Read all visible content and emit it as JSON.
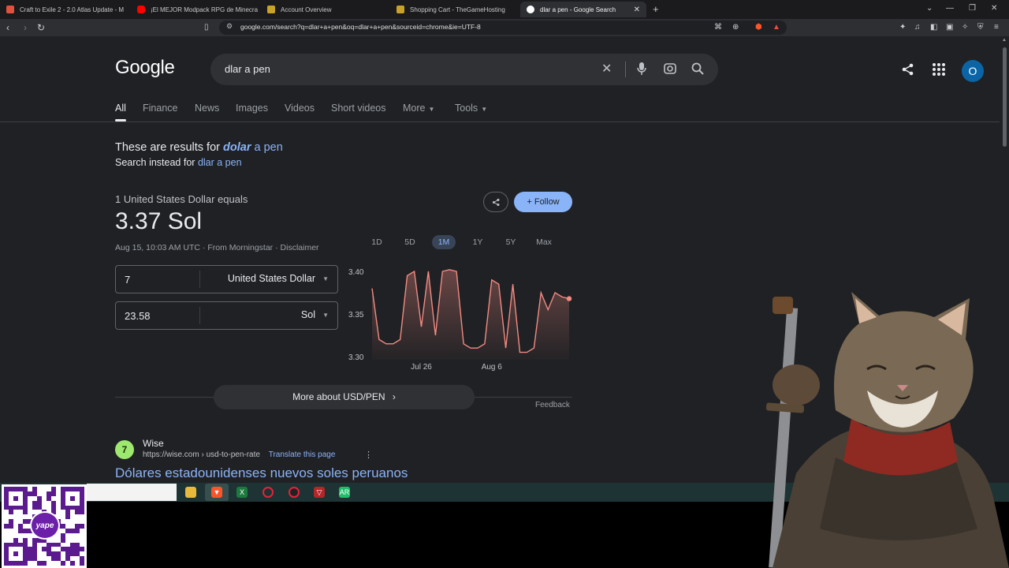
{
  "browser": {
    "tabs": [
      {
        "title": "Craft to Exile 2 - 2.0 Atlas Update - M",
        "favicon_color": "#e0523b"
      },
      {
        "title": "¡El MEJOR Modpack RPG de Minecra",
        "favicon_color": "#ff0000"
      },
      {
        "title": "Account Overview",
        "favicon_color": "#c9a227"
      },
      {
        "title": "Shopping Cart - TheGameHosting",
        "favicon_color": "#c9a227"
      },
      {
        "title": "dlar a pen - Google Search",
        "favicon_color": "#ffffff",
        "active": true
      }
    ],
    "url": "google.com/search?q=dlar+a+pen&oq=dlar+a+pen&sourceid=chrome&ie=UTF-8"
  },
  "google": {
    "logo": "Google",
    "query": "dlar a pen",
    "avatar_letter": "O",
    "filters": [
      {
        "label": "All",
        "active": true
      },
      {
        "label": "Finance"
      },
      {
        "label": "News"
      },
      {
        "label": "Images"
      },
      {
        "label": "Videos"
      },
      {
        "label": "Short videos"
      },
      {
        "label": "More"
      },
      {
        "label": "Tools"
      }
    ],
    "correction": {
      "prefix": "These are results for",
      "corrected_bold": "dolar",
      "corrected_rest": " a pen",
      "instead_prefix": "Search instead for",
      "instead_link": "dlar a pen"
    }
  },
  "currency": {
    "equals_text": "1 United States Dollar equals",
    "rate_text": "3.37 Sol",
    "timestamp": "Aug 15, 10:03 AM UTC",
    "source": "From Morningstar",
    "disclaimer": "Disclaimer",
    "follow_label": "Follow",
    "from": {
      "value": "7",
      "currency": "United States Dollar"
    },
    "to": {
      "value": "23.58",
      "currency": "Sol"
    },
    "ranges": [
      {
        "label": "1D"
      },
      {
        "label": "5D"
      },
      {
        "label": "1M",
        "selected": true
      },
      {
        "label": "1Y"
      },
      {
        "label": "5Y"
      },
      {
        "label": "Max"
      }
    ],
    "more_about": "More about USD/PEN",
    "feedback": "Feedback"
  },
  "chart_data": {
    "type": "line",
    "series": [
      {
        "values": [
          3.38,
          3.32,
          3.315,
          3.315,
          3.32,
          3.395,
          3.4,
          3.335,
          3.4,
          3.325,
          3.4,
          3.402,
          3.4,
          3.315,
          3.31,
          3.31,
          3.315,
          3.39,
          3.385,
          3.31,
          3.385,
          3.305,
          3.305,
          3.31,
          3.375,
          3.355,
          3.375,
          3.37,
          3.368
        ]
      }
    ],
    "y_ticks": [
      "3.40",
      "3.35",
      "3.30"
    ],
    "x_ticks": [
      "Jul 26",
      "Aug 6"
    ],
    "ylim": [
      3.3,
      3.4
    ],
    "line_color": "#f28b82"
  },
  "result": {
    "site_name": "Wise",
    "site_url": "https://wise.com › usd-to-pen-rate",
    "translate": "Translate this page",
    "title": "Dólares estadounidenses nuevos soles peruanos"
  },
  "overlay": {
    "qr_badge": "yape"
  }
}
